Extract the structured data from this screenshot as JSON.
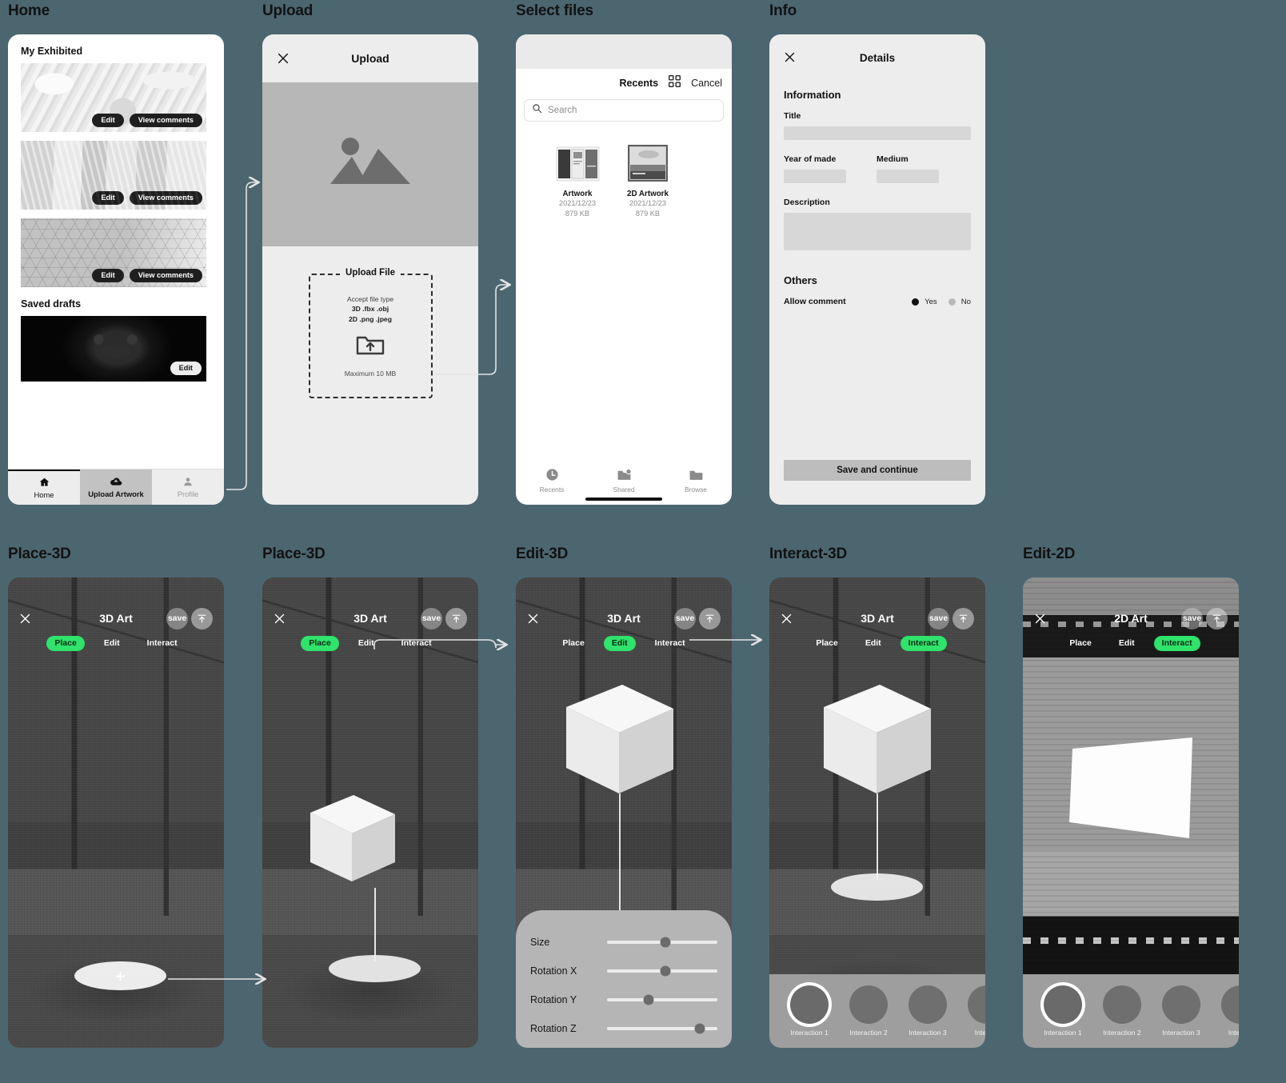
{
  "theme": {
    "background": "#4c6670",
    "accent_green": "#2fe36b",
    "dark_pill": "#1f1f1f"
  },
  "flows": {
    "home": "Home",
    "upload": "Upload",
    "select_files": "Select files",
    "info": "Info",
    "place3d_a": "Place-3D",
    "place3d_b": "Place-3D",
    "edit3d": "Edit-3D",
    "interact3d": "Interact-3D",
    "edit2d": "Edit-2D"
  },
  "home": {
    "section_exhibited": "My Exhibited",
    "section_drafts": "Saved drafts",
    "exhibited": [
      {
        "edit": "Edit",
        "comments": "View comments"
      },
      {
        "edit": "Edit",
        "comments": "View comments"
      },
      {
        "edit": "Edit",
        "comments": "View comments"
      }
    ],
    "drafts": [
      {
        "edit": "Edit"
      }
    ],
    "tabs": [
      {
        "label": "Home",
        "icon": "home-icon"
      },
      {
        "label": "Upload Artwork",
        "icon": "cloud-upload-icon"
      },
      {
        "label": "Profile",
        "icon": "person-icon"
      }
    ]
  },
  "upload": {
    "title": "Upload",
    "close_icon": "close-icon",
    "preview_icon": "image-placeholder-icon",
    "dropzone": {
      "legend": "Upload File",
      "accept_label": "Accept file type",
      "accept_3d": "3D .fbx .obj",
      "accept_2d": "2D .png .jpeg",
      "folder_icon": "folder-upload-icon",
      "max_size": "Maximum 10 MB"
    }
  },
  "files": {
    "title": "Recents",
    "grid_icon": "grid-view-icon",
    "cancel": "Cancel",
    "search_placeholder": "Search",
    "search_icon": "search-icon",
    "items": [
      {
        "name": "Artwork",
        "date": "2021/12/23",
        "size": "879 KB",
        "thumb": "multi-page-thumb"
      },
      {
        "name": "2D Artwork",
        "date": "2021/12/23",
        "size": "879 KB",
        "thumb": "landscape-photo-thumb"
      }
    ],
    "tabs": [
      {
        "label": "Recents",
        "icon": "clock-icon"
      },
      {
        "label": "Shared",
        "icon": "shared-folder-icon"
      },
      {
        "label": "Browse",
        "icon": "folder-icon"
      }
    ]
  },
  "details": {
    "title": "Details",
    "close_icon": "close-icon",
    "section_information": "Information",
    "section_others": "Others",
    "fields": {
      "title": {
        "label": "Title",
        "value": ""
      },
      "year": {
        "label": "Year of made",
        "value": ""
      },
      "medium": {
        "label": "Medium",
        "value": ""
      },
      "description": {
        "label": "Description",
        "value": ""
      }
    },
    "allow_comment": {
      "label": "Allow comment",
      "yes": "Yes",
      "no": "No",
      "selected": "Yes"
    },
    "save_button": "Save and continue"
  },
  "ar_common": {
    "close_icon": "close-icon",
    "save_label": "save",
    "share_icon": "share-upload-icon",
    "modes": [
      "Place",
      "Edit",
      "Interact"
    ]
  },
  "ar_screens": [
    {
      "id": "place3d-empty",
      "title": "3D Art",
      "active_mode": "Place",
      "add_icon": "plus-icon"
    },
    {
      "id": "place3d-placed",
      "title": "3D Art",
      "active_mode": "Place"
    },
    {
      "id": "edit3d",
      "title": "3D Art",
      "active_mode": "Edit"
    },
    {
      "id": "interact3d",
      "title": "3D Art",
      "active_mode": "Interact"
    },
    {
      "id": "edit2d",
      "title": "2D Art",
      "active_mode": "Interact"
    }
  ],
  "edit3d_sliders": [
    {
      "label": "Size",
      "value": 53
    },
    {
      "label": "Rotation X",
      "value": 53
    },
    {
      "label": "Rotation Y",
      "value": 38
    },
    {
      "label": "Rotation Z",
      "value": 84
    }
  ],
  "interactions": [
    {
      "label": "Interaction 1",
      "selected": true
    },
    {
      "label": "Interaction 2",
      "selected": false
    },
    {
      "label": "Interaction 3",
      "selected": false
    },
    {
      "label": "Interacti",
      "selected": false
    }
  ]
}
